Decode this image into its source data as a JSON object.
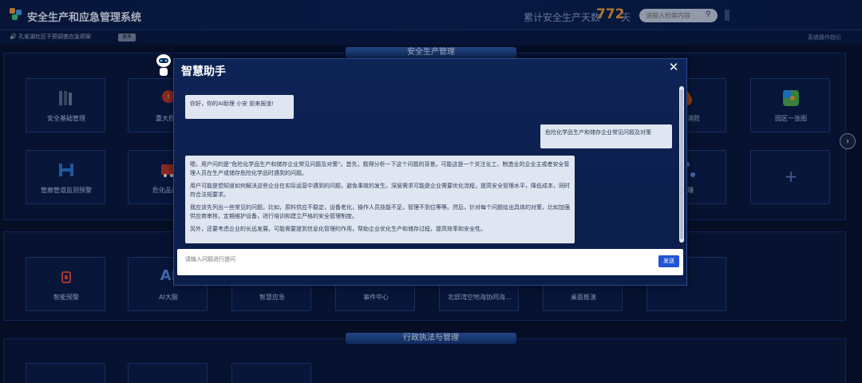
{
  "header": {
    "app_title": "安全生产和应急管理系统",
    "days_label": "累计安全生产天数",
    "days_value": "772",
    "days_unit": "天",
    "search_placeholder": "请输入检索内容"
  },
  "subheader": {
    "notice": "孔雀湖社区干预调查应急预案",
    "more_label": "更多",
    "guide_link": "系统操作指引"
  },
  "sections": {
    "safety_title": "安全生产管理",
    "admin_title": "行政执法与管理"
  },
  "tiles_row1": [
    {
      "label": "安全基础管理",
      "icon": "books-icon"
    },
    {
      "label": "重大危险",
      "icon": "danger-pin-icon"
    },
    {
      "label": "",
      "icon": ""
    },
    {
      "label": "",
      "icon": ""
    },
    {
      "label": "",
      "icon": ""
    },
    {
      "label": "",
      "icon": ""
    },
    {
      "label": "生态消防",
      "icon": "fire-icon"
    },
    {
      "label": "园区一张图",
      "icon": "map-icon"
    }
  ],
  "tiles_row2": [
    {
      "label": "管廊管道监测预警",
      "icon": "pipeline-icon"
    },
    {
      "label": "危化品运输",
      "icon": "truck-icon"
    },
    {
      "label": "",
      "icon": ""
    },
    {
      "label": "",
      "icon": ""
    },
    {
      "label": "",
      "icon": ""
    },
    {
      "label": "",
      "icon": ""
    },
    {
      "label": "涉爆",
      "icon": "network-icon"
    },
    {
      "label": "",
      "icon": "plus-icon"
    }
  ],
  "tiles_row3": [
    {
      "label": "智能预警",
      "icon": "alarm-icon"
    },
    {
      "label": "AI大脑",
      "icon": "ai-icon"
    },
    {
      "label": "智慧应急",
      "icon": ""
    },
    {
      "label": "事件中心",
      "icon": ""
    },
    {
      "label": "北部湾空地海协同海…",
      "icon": ""
    },
    {
      "label": "桌面推演",
      "icon": ""
    },
    {
      "label": "",
      "icon": ""
    }
  ],
  "modal": {
    "title": "智慧助手",
    "greeting": "你好，你的AI助理 小安 前来报道!",
    "user_question": "危险化学品生产和储存企业常见问题及对策",
    "reply_p1": "嗯，用户问的是\"危险化学品生产和储存企业常见问题及对策\"。首先，我得分析一下这个问题的背景。可能这是一个关注化工、制造业的企业主或者安全管理人员在生产或储存危险化学品时遇到的问题。",
    "reply_p2": "用户可能是想知道如何解决这些企业在实际运营中遇到的问题，避免事故的发生。深层需求可能是企业需要优化流程，提高安全管理水平，降低成本，同时符合法规要求。",
    "reply_p3": "我应该先列出一些常见的问题，比如，原料供应不稳定，设备老化，操作人员技能不足，管理不到位等等。然后，针对每个问题给出具体的对策，比如加强供应商审核，定期维护设备，进行培训和建立严格的安全管理制度。",
    "reply_p4": "另外，还要考虑企业的长远发展，可能需要提到信息化管理的作用，帮助企业优化生产和储存过程，提高效率和安全性。",
    "input_placeholder": "请输入问题进行提问",
    "send_label": "发送"
  },
  "colors": {
    "accent": "#2154d6",
    "highlight": "#f2a23a",
    "background": "#07132f"
  }
}
